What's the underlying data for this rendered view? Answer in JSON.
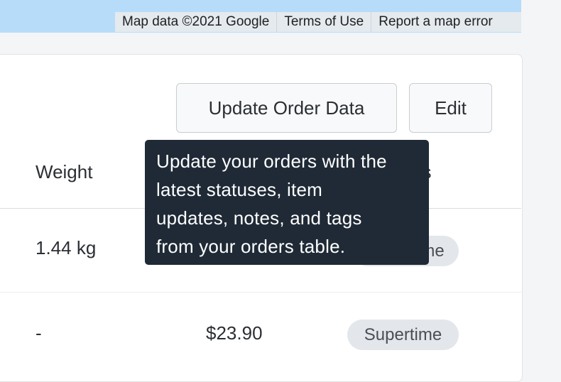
{
  "map": {
    "attribution": "Map data ©2021 Google",
    "terms": "Terms of Use",
    "report": "Report a map error"
  },
  "toolbar": {
    "update_label": "Update Order Data",
    "edit_label": "Edit"
  },
  "tooltip": {
    "lines": [
      "Update your orders with the",
      "latest statuses, item",
      "updates, notes, and tags",
      "from your orders table."
    ]
  },
  "table": {
    "headers": {
      "weight": "Weight",
      "tags_tail": "gs"
    },
    "rows": [
      {
        "weight": "1.44 kg",
        "price": "",
        "tag": "Supertime"
      },
      {
        "weight": "-",
        "price": "$23.90",
        "tag": "Supertime"
      }
    ]
  }
}
